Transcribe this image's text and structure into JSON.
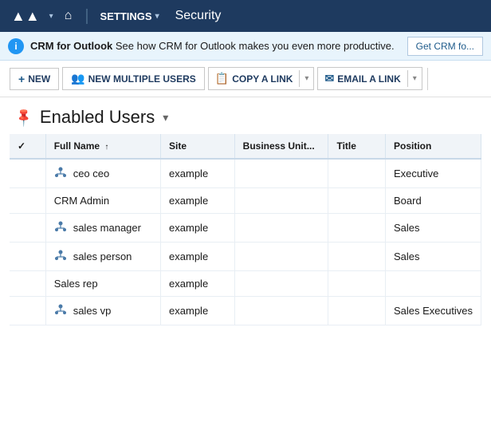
{
  "nav": {
    "logo": "▲▲",
    "home_label": "⌂",
    "settings_label": "SETTINGS",
    "security_label": "Security"
  },
  "notification": {
    "icon": "i",
    "product": "CRM for Outlook",
    "message": "See how CRM for Outlook makes you even more productive.",
    "button": "Get CRM fo..."
  },
  "toolbar": {
    "new_label": "NEW",
    "new_multiple_label": "NEW MULTIPLE USERS",
    "copy_link_label": "COPY A LINK",
    "email_link_label": "EMAIL A LINK"
  },
  "page": {
    "title": "Enabled Users",
    "title_chevron": "▾"
  },
  "table": {
    "columns": [
      "",
      "Full Name",
      "Site",
      "Business Unit...",
      "Title",
      "Position"
    ],
    "rows": [
      {
        "icon": true,
        "name": "ceo ceo",
        "site": "example",
        "business_unit": "",
        "title": "",
        "position": "Executive"
      },
      {
        "icon": false,
        "name": "CRM Admin",
        "site": "example",
        "business_unit": "",
        "title": "",
        "position": "Board"
      },
      {
        "icon": true,
        "name": "sales manager",
        "site": "example",
        "business_unit": "",
        "title": "",
        "position": "Sales"
      },
      {
        "icon": true,
        "name": "sales person",
        "site": "example",
        "business_unit": "",
        "title": "",
        "position": "Sales"
      },
      {
        "icon": false,
        "name": "Sales rep",
        "site": "example",
        "business_unit": "",
        "title": "",
        "position": ""
      },
      {
        "icon": true,
        "name": "sales vp",
        "site": "example",
        "business_unit": "",
        "title": "",
        "position": "Sales Executives"
      }
    ]
  }
}
